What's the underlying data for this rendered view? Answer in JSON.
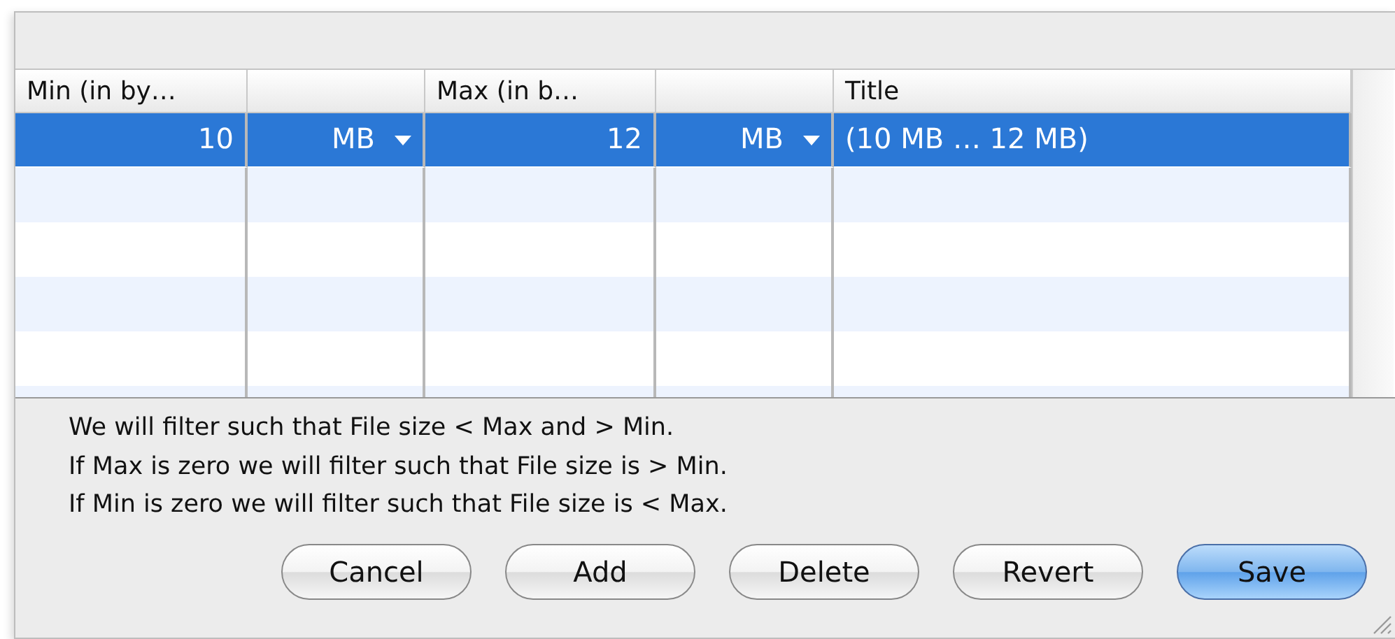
{
  "table": {
    "columns": [
      {
        "label": "Min (in by…",
        "kind": "number"
      },
      {
        "kind": "unit"
      },
      {
        "label": "Max (in b…",
        "kind": "number"
      },
      {
        "kind": "unit"
      },
      {
        "label": "Title",
        "kind": "text"
      }
    ],
    "rows": [
      {
        "selected": true,
        "cells": [
          "10",
          "MB",
          "12",
          "MB",
          "(10 MB … 12 MB)"
        ]
      }
    ]
  },
  "notes": [
    "We will filter such that File size < Max and > Min.",
    "If Max is zero we will filter such that File size is > Min.",
    "If Min is zero we will filter such that File size is < Max."
  ],
  "buttons": [
    {
      "label": "Cancel",
      "default": false
    },
    {
      "label": "Add",
      "default": false
    },
    {
      "label": "Delete",
      "default": false
    },
    {
      "label": "Revert",
      "default": false
    },
    {
      "label": "Save",
      "default": true
    }
  ]
}
